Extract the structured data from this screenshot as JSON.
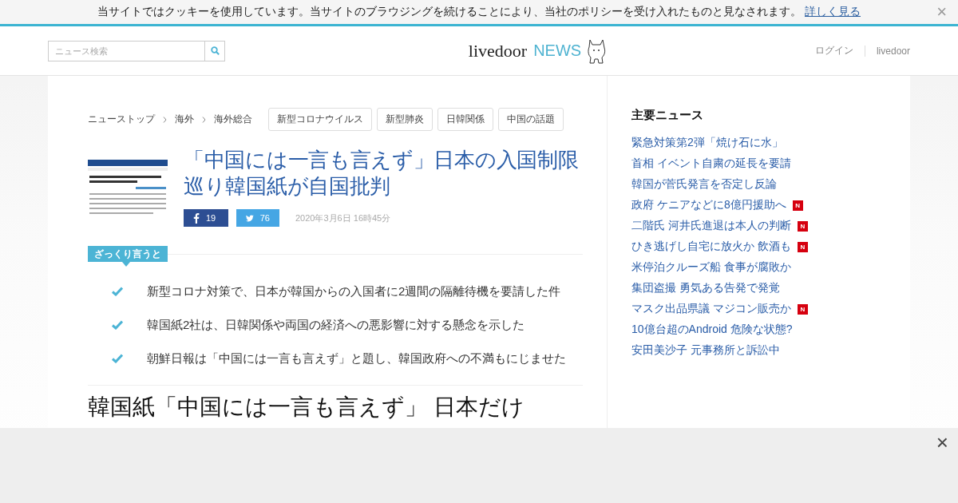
{
  "cookie_bar": {
    "text": "当サイトではクッキーを使用しています。当サイトのブラウジングを続けることにより、当社のポリシーを受け入れたものと見なされます。",
    "link": "詳しく見る",
    "close": "×"
  },
  "header": {
    "search": {
      "placeholder": "ニュース検索"
    },
    "logo": {
      "word": "livedoor",
      "suffix": "NEWS"
    },
    "links": [
      "ログイン",
      "livedoor"
    ]
  },
  "breadcrumbs": [
    "ニューストップ",
    "海外",
    "海外総合"
  ],
  "tags": [
    "新型コロナウイルス",
    "新型肺炎",
    "日韓関係",
    "中国の話題"
  ],
  "article": {
    "title": "「中国には一言も言えず」日本の入国制限巡り韓国紙が自国批判",
    "facebook_count": "19",
    "twitter_count": "76",
    "date": "2020年3月6日 16時45分"
  },
  "summary": {
    "label": "ざっくり言うと",
    "points": [
      "新型コロナ対策で、日本が韓国からの入国者に2週間の隔離待機を要請した件",
      "韓国紙2社は、日韓関係や両国の経済への悪影響に対する懸念を示した",
      "朝鮮日報は「中国には一言も言えず」と題し、韓国政府への不満もにじませた"
    ]
  },
  "body_heading": "韓国紙「中国には一言も言えず」 日本だけ",
  "sidebar": {
    "title": "主要ニュース",
    "items": [
      {
        "text": "緊急対策第2弾「焼け石に水」"
      },
      {
        "text": "首相 イベント自粛の延長を要請"
      },
      {
        "text": "韓国が菅氏発言を否定し反論"
      },
      {
        "text": "政府 ケニアなどに8億円援助へ",
        "badge": "N"
      },
      {
        "text": "二階氏 河井氏進退は本人の判断",
        "badge": "N"
      },
      {
        "text": "ひき逃げし自宅に放火か 飲酒も",
        "badge": "N"
      },
      {
        "text": "米停泊クルーズ船 食事が腐敗か"
      },
      {
        "text": "集団盗撮 勇気ある告発で発覚"
      },
      {
        "text": "マスク出品県議 マジコン販売か",
        "badge": "N"
      },
      {
        "text": "10億台超のAndroid 危険な状態?"
      },
      {
        "text": "安田美沙子 元事務所と訴訟中"
      }
    ]
  },
  "ad_overlay": {
    "close": "×"
  }
}
